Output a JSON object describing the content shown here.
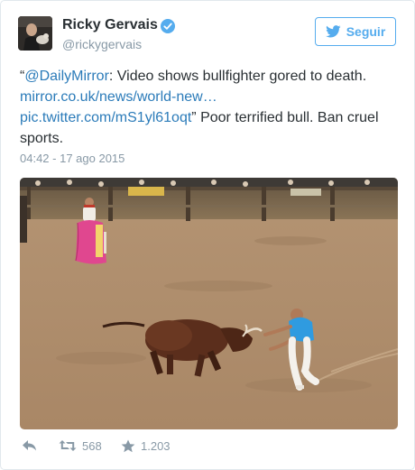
{
  "user": {
    "display_name": "Ricky Gervais",
    "handle": "@rickygervais",
    "verified": true
  },
  "follow_button": {
    "label": "Seguir",
    "icon": "twitter-bird-icon"
  },
  "tweet": {
    "open_quote": "“",
    "mention": "@DailyMirror",
    "text_after_mention": ": Video shows bullfighter gored to death.",
    "link_1": "mirror.co.uk/news/world-new…",
    "link_2": "pic.twitter.com/mS1yl61oqt",
    "text_after_links": "” Poor terrified bull. Ban cruel sports."
  },
  "timestamp": "04:42 - 17 ago 2015",
  "media": {
    "kind": "photo"
  },
  "actions": {
    "reply_icon": "reply-icon",
    "retweet_icon": "retweet-icon",
    "retweet_count": "568",
    "favorite_icon": "star-icon",
    "favorite_count": "1.203"
  },
  "colors": {
    "link": "#2b7bb9",
    "accent": "#55acee",
    "muted": "#8899a6",
    "text": "#292f33",
    "verified": "#55acee"
  }
}
